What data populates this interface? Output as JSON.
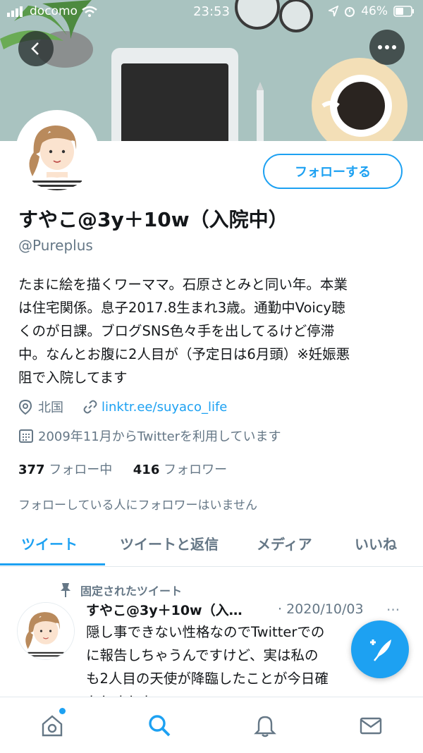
{
  "status_bar": {
    "carrier": "docomo",
    "time": "23:53",
    "battery": "46%"
  },
  "header": {
    "back_icon": "back-arrow-icon",
    "more_icon": "more-icon"
  },
  "profile": {
    "follow_label": "フォローする",
    "display_name": "すやこ@3y＋10w（入院中）",
    "handle": "@Pureplus",
    "bio_lines": [
      "たまに絵を描くワーママ。石原さとみと同い年。本業",
      "は住宅関係。息子2017.8生まれ3歳。通勤中Voicy聴",
      "くのが日課。ブログSNS色々手を出してるけど停滞",
      "中。なんとお腹に2人目が（予定日は6月頭）※妊娠悪",
      "阻で入院してます"
    ],
    "location": "北国",
    "link": "linktr.ee/suyaco_life",
    "joined": "2009年11月からTwitterを利用しています",
    "following_count": "377",
    "following_label": "フォロー中",
    "followers_count": "416",
    "followers_label": "フォロワー",
    "no_mutual_text": "フォローしている人にフォロワーはいません"
  },
  "tabs": [
    "ツイート",
    "ツイートと返信",
    "メディア",
    "いいね"
  ],
  "tweet": {
    "pinned_label": "固定されたツイート",
    "name": "すやこ@3y＋10w（入…",
    "date": "· 2020/10/03",
    "more": "···",
    "body_lines": [
      "隠し事できない性格なのでTwitterでの",
      "に報告しちゃうんですけど、実は私の",
      "も2人目の天使が降臨したことが今日確",
      "たしました"
    ]
  },
  "colors": {
    "accent": "#1da1f2",
    "secondary_text": "#657786",
    "banner": "#a8c2bf"
  }
}
